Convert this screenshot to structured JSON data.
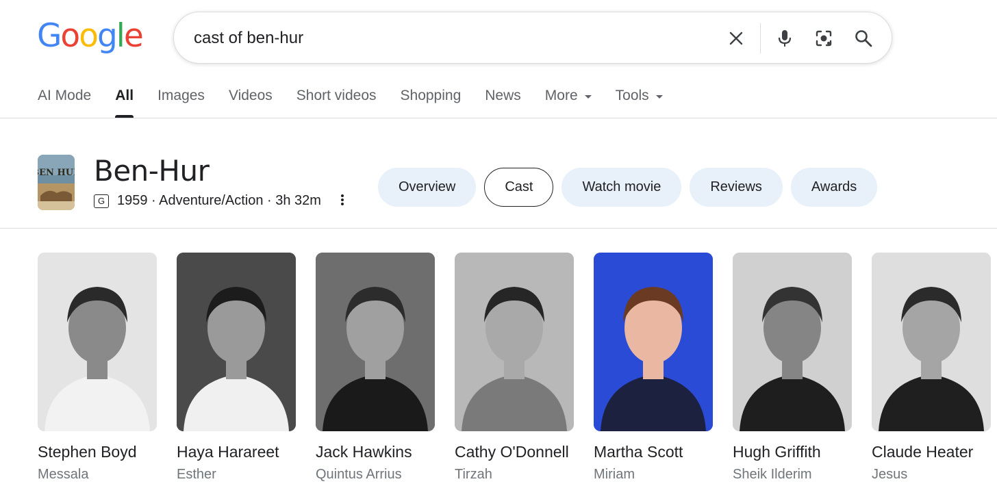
{
  "logo": {
    "letters": [
      "G",
      "o",
      "o",
      "g",
      "l",
      "e"
    ],
    "colors": [
      "#4285F4",
      "#EA4335",
      "#FBBC05",
      "#4285F4",
      "#34A853",
      "#EA4335"
    ]
  },
  "search": {
    "query": "cast of ben-hur"
  },
  "icons": {
    "clear": "close-icon",
    "voice": "microphone-icon",
    "lens": "camera-lens-icon",
    "search": "search-icon"
  },
  "tabs": [
    {
      "label": "AI Mode"
    },
    {
      "label": "All",
      "active": true
    },
    {
      "label": "Images"
    },
    {
      "label": "Videos"
    },
    {
      "label": "Short videos"
    },
    {
      "label": "Shopping"
    },
    {
      "label": "News"
    },
    {
      "label": "More",
      "dropdown": true
    },
    {
      "label": "Tools",
      "dropdown": true
    }
  ],
  "entity": {
    "title": "Ben-Hur",
    "poster_text": "BEN HUR",
    "rating": "G",
    "meta": "1959 · Adventure/Action · 3h 32m"
  },
  "chips": [
    {
      "label": "Overview"
    },
    {
      "label": "Cast",
      "selected": true
    },
    {
      "label": "Watch movie"
    },
    {
      "label": "Reviews"
    },
    {
      "label": "Awards"
    }
  ],
  "cast": [
    {
      "actor": "Stephen Boyd",
      "role": "Messala",
      "bg": "#e4e4e4",
      "tone": "#8a8a8a",
      "hair": "#2a2a2a",
      "cloth": "#f2f2f2"
    },
    {
      "actor": "Haya Harareet",
      "role": "Esther",
      "bg": "#4a4a4a",
      "tone": "#9a9a9a",
      "hair": "#1c1c1c",
      "cloth": "#f0f0f0"
    },
    {
      "actor": "Jack Hawkins",
      "role": "Quintus Arrius",
      "bg": "#6e6e6e",
      "tone": "#a0a0a0",
      "hair": "#2c2c2c",
      "cloth": "#1a1a1a"
    },
    {
      "actor": "Cathy O'Donnell",
      "role": "Tirzah",
      "bg": "#b8b8b8",
      "tone": "#a9a9a9",
      "hair": "#262626",
      "cloth": "#7a7a7a"
    },
    {
      "actor": "Martha Scott",
      "role": "Miriam",
      "bg": "#2a4bd6",
      "tone": "#e9b7a2",
      "hair": "#6b3a22",
      "cloth": "#1c2140"
    },
    {
      "actor": "Hugh Griffith",
      "role": "Sheik Ilderim",
      "bg": "#d0d0d0",
      "tone": "#858585",
      "hair": "#333333",
      "cloth": "#1e1e1e"
    },
    {
      "actor": "Claude Heater",
      "role": "Jesus",
      "bg": "#dedede",
      "tone": "#a5a5a5",
      "hair": "#2b2b2b",
      "cloth": "#1f1f1f"
    }
  ]
}
